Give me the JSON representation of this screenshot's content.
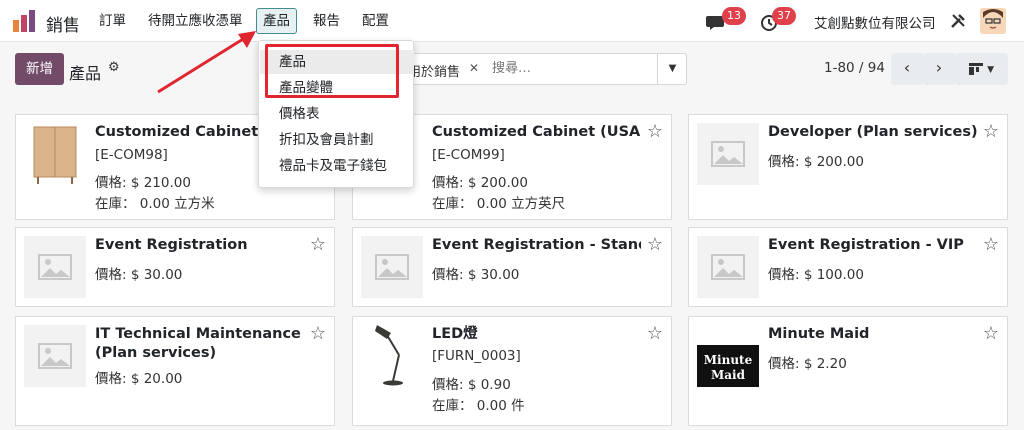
{
  "navbar": {
    "app_name": "銷售",
    "menu": [
      {
        "label": "訂單"
      },
      {
        "label": "待開立應收憑單"
      },
      {
        "label": "產品"
      },
      {
        "label": "報告"
      },
      {
        "label": "配置"
      }
    ],
    "messages_count": "13",
    "activities_count": "37",
    "company": "艾創點數位有限公司"
  },
  "control": {
    "new_label": "新增",
    "title": "產品",
    "search_facet": "用於銷售",
    "search_placeholder": "搜尋…",
    "pager": "1-80 / 94"
  },
  "dropdown": {
    "items": [
      {
        "label": "產品"
      },
      {
        "label": "產品變體"
      },
      {
        "label": "價格表"
      },
      {
        "label": "折扣及會員計劃"
      },
      {
        "label": "禮品卡及電子錢包"
      }
    ]
  },
  "cards": [
    {
      "title": "Customized Cabinet (Metric)",
      "ref": "[E-COM98]",
      "price": "價格: $ 210.00",
      "stock": "在庫： 0.00 立方米"
    },
    {
      "title": "Customized Cabinet (USA)",
      "ref": "[E-COM99]",
      "price": "價格: $ 200.00",
      "stock": "在庫： 0.00 立方英尺"
    },
    {
      "title": "Developer (Plan services)",
      "price": "價格: $ 200.00"
    },
    {
      "title": "Event Registration",
      "price": "價格: $ 30.00"
    },
    {
      "title": "Event Registration - Standard",
      "price": "價格: $ 30.00"
    },
    {
      "title": "Event Registration - VIP",
      "price": "價格: $ 100.00"
    },
    {
      "title": "IT Technical Maintenance (Plan services)",
      "price": "價格: $ 20.00"
    },
    {
      "title": "LED燈",
      "ref": "[FURN_0003]",
      "price": "價格: $ 0.90",
      "stock": "在庫： 0.00 件"
    },
    {
      "title": "Minute Maid",
      "price": "價格: $ 2.20",
      "logo_text": "Minute Maid"
    }
  ],
  "colors": {
    "brand": "#714b67",
    "highlight": "#e0262f",
    "badge": "#e0404a"
  }
}
